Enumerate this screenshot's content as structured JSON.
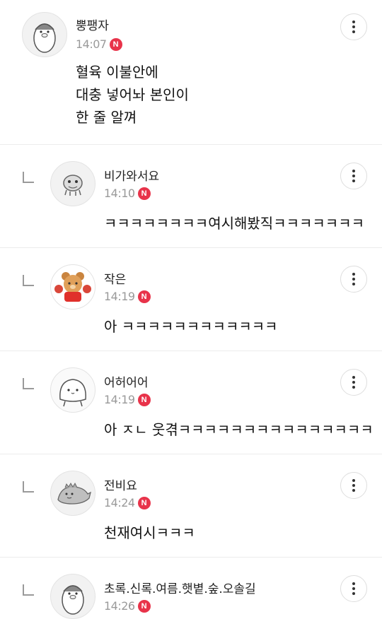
{
  "comments": [
    {
      "author": "뿡팽자",
      "time": "14:07",
      "badge": "N",
      "lines": [
        "혈육 이불안에",
        "대충 넣어놔 본인이",
        "한 줄 알껴"
      ],
      "avatar_icon": "penguin-avatar-icon"
    },
    {
      "author": "비가와서요",
      "time": "14:10",
      "badge": "N",
      "text": "ㅋㅋㅋㅋㅋㅋㅋㅋ여시해봤직ㅋㅋㅋㅋㅋㅋㅋ",
      "avatar_icon": "doodle-avatar-icon"
    },
    {
      "author": "작은",
      "time": "14:19",
      "badge": "N",
      "text": "아 ㅋㅋㅋㅋㅋㅋㅋㅋㅋㅋㅋㅋ",
      "avatar_icon": "bear-avatar-icon"
    },
    {
      "author": "어허어어",
      "time": "14:19",
      "badge": "N",
      "text": "아 ㅈㄴ 웃겪ㅋㅋㅋㅋㅋㅋㅋㅋㅋㅋㅋㅋㅋㅋㅋ",
      "avatar_icon": "blob-avatar-icon"
    },
    {
      "author": "전비요",
      "time": "14:24",
      "badge": "N",
      "text": "천재여시ㅋㅋㅋ",
      "avatar_icon": "dino-avatar-icon"
    },
    {
      "author": "초록.신록.여름.햇볕.숲.오솔길",
      "time": "14:26",
      "badge": "N",
      "text": "",
      "avatar_icon": "penguin-avatar-icon"
    }
  ],
  "colors": {
    "badge": "#e8334a",
    "time": "#9a9a9a",
    "divider": "#ececec"
  }
}
